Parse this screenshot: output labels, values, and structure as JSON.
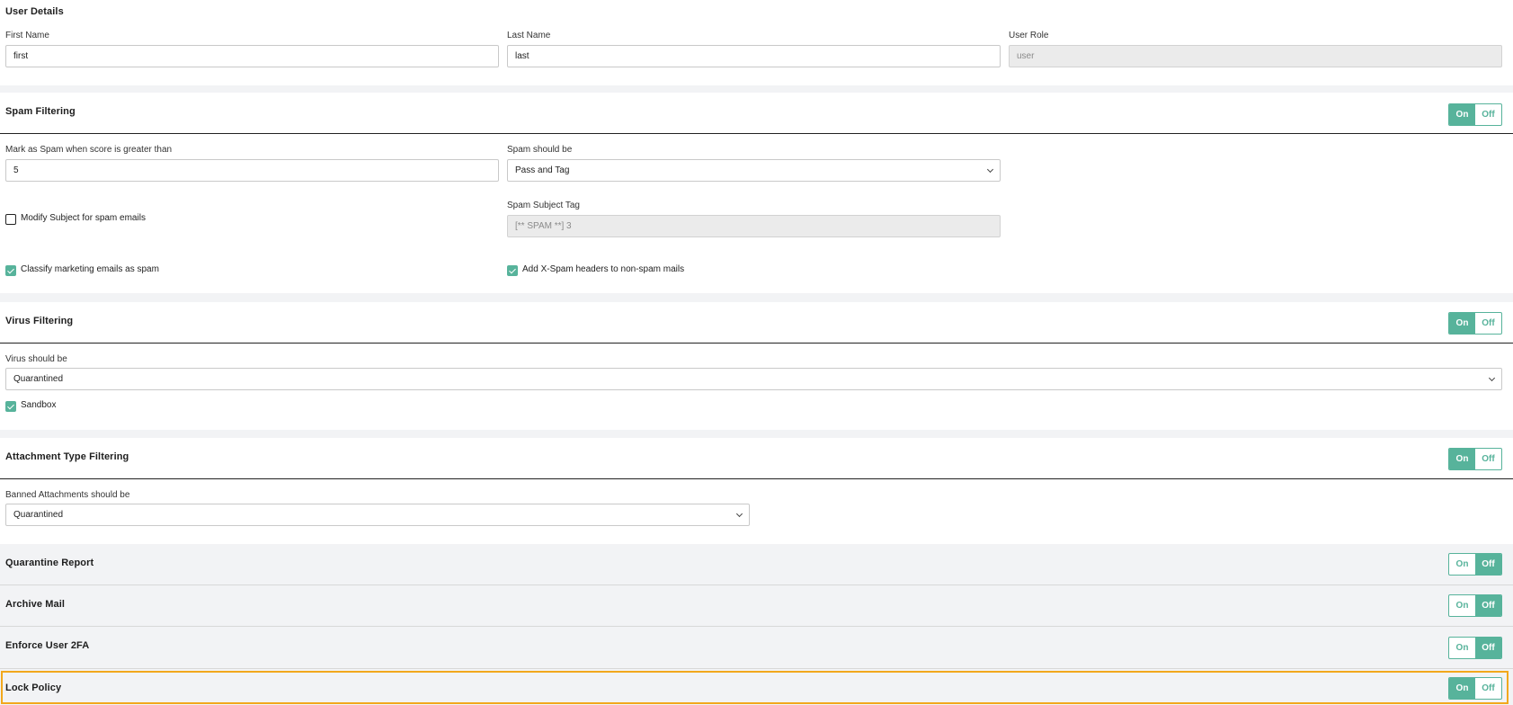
{
  "user_details": {
    "title": "User Details",
    "first_name_label": "First Name",
    "first_name_value": "first",
    "last_name_label": "Last Name",
    "last_name_value": "last",
    "user_role_label": "User Role",
    "user_role_placeholder": "user"
  },
  "toggle": {
    "on_label": "On",
    "off_label": "Off"
  },
  "spam": {
    "title": "Spam Filtering",
    "state": "on",
    "score_label": "Mark as Spam when score is greater than",
    "score_value": "5",
    "action_label": "Spam should be",
    "action_value": "Pass and Tag",
    "modify_subject_label": "Modify Subject for spam emails",
    "modify_subject_checked": false,
    "subject_tag_label": "Spam Subject Tag",
    "subject_tag_placeholder": "[** SPAM **] 3",
    "classify_marketing_label": "Classify marketing emails as spam",
    "classify_marketing_checked": true,
    "xspam_headers_label": "Add X-Spam headers to non-spam mails",
    "xspam_headers_checked": true
  },
  "virus": {
    "title": "Virus Filtering",
    "state": "on",
    "action_label": "Virus should be",
    "action_value": "Quarantined",
    "sandbox_label": "Sandbox",
    "sandbox_checked": true
  },
  "attachment": {
    "title": "Attachment Type Filtering",
    "state": "on",
    "action_label": "Banned Attachments should be",
    "action_value": "Quarantined"
  },
  "quarantine_report": {
    "title": "Quarantine Report",
    "state": "off"
  },
  "archive_mail": {
    "title": "Archive Mail",
    "state": "off"
  },
  "enforce_2fa": {
    "title": "Enforce User 2FA",
    "state": "off"
  },
  "lock_policy": {
    "title": "Lock Policy",
    "state": "on"
  },
  "colors": {
    "accent": "#57b39b",
    "highlight": "#f2a81c",
    "panel_grey": "#f2f3f5"
  }
}
